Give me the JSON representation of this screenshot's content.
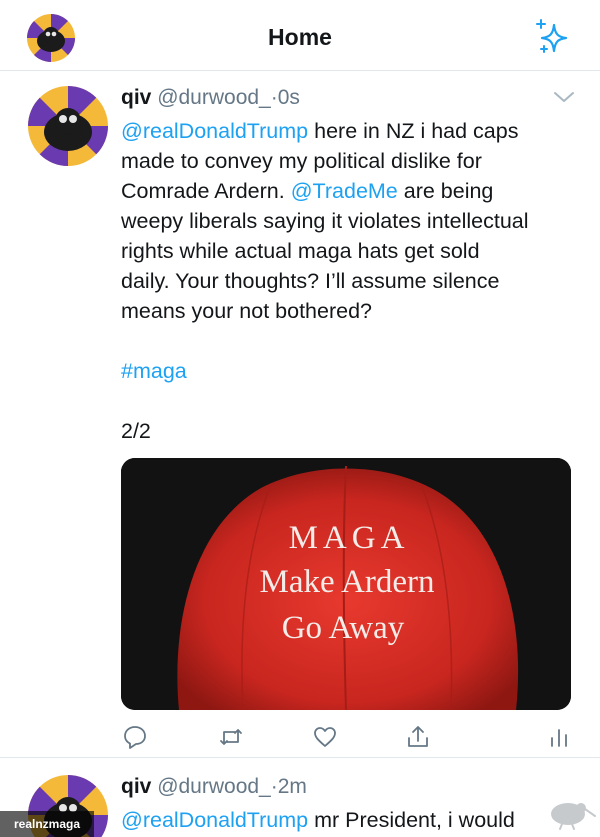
{
  "header": {
    "title": "Home",
    "sparkle_icon": "sparkle-icon",
    "accent": "#1da1f2"
  },
  "tweets": [
    {
      "name": "qiv",
      "handle": "@durwood_",
      "dot": "·",
      "time": "0s",
      "lines": [
        {
          "mention": "@realDonaldTrump",
          "text": " here in NZ i had caps"
        },
        {
          "text": "made to convey my political dislike for"
        },
        {
          "text": "Comrade Ardern. ",
          "mention": "@TradeMe",
          "after": " are being"
        },
        {
          "text": "weepy liberals saying it violates intellectual"
        },
        {
          "text": "rights while actual maga hats get sold"
        },
        {
          "text": "daily. Your thoughts? I’ll assume silence"
        },
        {
          "text": "means your not bothered?"
        }
      ],
      "hashtag": "#maga",
      "thread_count": "2/2",
      "image": {
        "cap_color": "#c8261f",
        "line1": "MAGA",
        "line2": "Make Ardern",
        "line3": "Go Away"
      }
    },
    {
      "name": "qiv",
      "handle": "@durwood_",
      "dot": "·",
      "time": "2m",
      "mention": "@realDonaldTrump",
      "text": " mr President, i would"
    }
  ],
  "watermark": {
    "label": "realnzmaga"
  }
}
